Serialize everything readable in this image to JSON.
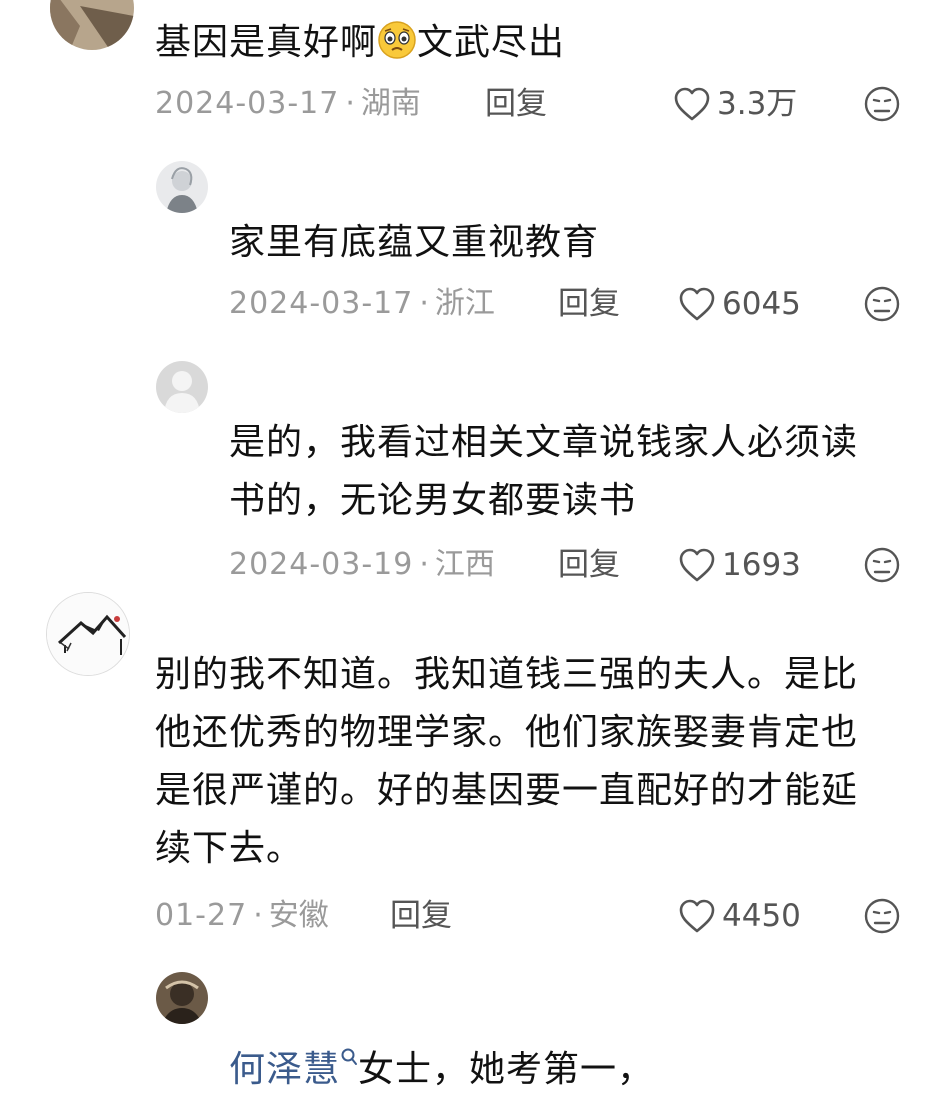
{
  "comments": [
    {
      "text_before": "基因是真好啊",
      "emoji": "pleading-face-emoji",
      "text_after": "文武尽出",
      "date": "2024-03-17",
      "location": "湖南",
      "reply": "回复",
      "likes": "3.3万"
    },
    {
      "text": "家里有底蕴又重视教育",
      "date": "2024-03-17",
      "location": "浙江",
      "reply": "回复",
      "likes": "6045"
    },
    {
      "lines": [
        "是的，我看过相关文章说钱家人必须读",
        "书的，无论男女都要读书"
      ],
      "date": "2024-03-19",
      "location": "江西",
      "reply": "回复",
      "likes": "1693"
    },
    {
      "lines": [
        "别的我不知道。我知道钱三强的夫人。是比",
        "他还优秀的物理学家。他们家族娶妻肯定也",
        "是很严谨的。好的基因要一直配好的才能延",
        "续下去。"
      ],
      "date": "01-27",
      "location": "安徽",
      "reply": "回复",
      "likes": "4450"
    },
    {
      "mention": "何泽慧",
      "text": "女士，她考第一，"
    }
  ],
  "separator": "·",
  "icons": {
    "like": "heart-outline-icon",
    "dislike": "sad-face-icon",
    "search": "search-icon"
  },
  "colors": {
    "meta": "#9a9a9a",
    "mention": "#3b5b8c"
  }
}
